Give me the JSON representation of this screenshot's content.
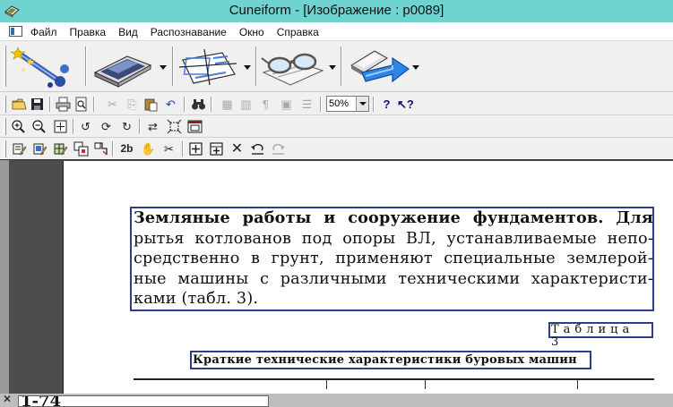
{
  "window": {
    "title": "Cuneiform - [Изображение : p0089]",
    "icon": "cuneiform-app-icon"
  },
  "menu": {
    "items": [
      "Файл",
      "Правка",
      "Вид",
      "Распознавание",
      "Окно",
      "Справка"
    ]
  },
  "big_toolbar": {
    "buttons": [
      {
        "name": "wizard-icon"
      },
      {
        "name": "scanner-icon"
      },
      {
        "name": "layout-page-icon"
      },
      {
        "name": "recognize-glasses-icon"
      },
      {
        "name": "save-export-icon"
      }
    ]
  },
  "toolbar_standard": {
    "zoom_value": "50%"
  },
  "document": {
    "para_lines": [
      "Земляные работы и сооружение фундаментов. Для",
      "рытья котлованов под опоры ВЛ, устанавливаемые непо-",
      "средственно в грунт, применяют специальные землерой-",
      "ные машины с различными техническими характеристи-",
      "ками (табл. 3)."
    ],
    "caption": "Таблица 3",
    "table_heading": "Краткие технические характеристики буровых машин"
  },
  "bottom_window": {
    "preview_text": "1-74"
  }
}
